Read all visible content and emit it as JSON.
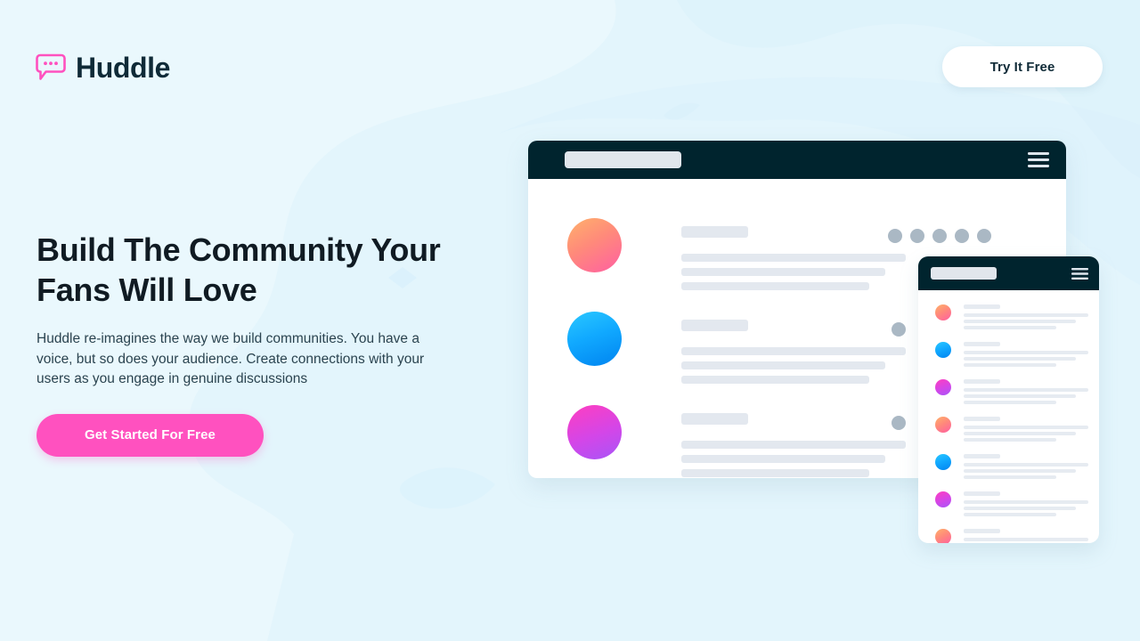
{
  "page": {
    "background_color": "#eaf8fd",
    "accent_pink": "#ff51bf",
    "dark_navy": "#00242e"
  },
  "header": {
    "brand": {
      "name": "Huddle",
      "logo_icon": "speech-bubble-icon",
      "logo_color": "#ff51bf"
    },
    "try_free_label": "Try It Free"
  },
  "hero": {
    "title": "Build The Community Your Fans Will Love",
    "subtitle": "Huddle re-imagines the way we build communities. You have a voice, but so does your audience. Create connections with your users as you engage in genuine discussions",
    "cta_label": "Get Started For Free"
  },
  "mockup": {
    "window": {
      "topbar_icon": "hamburger-menu-icon",
      "rows": [
        {
          "avatar_gradient": "grad-warm",
          "dots": 5
        },
        {
          "avatar_gradient": "grad-cool",
          "dots": 1
        },
        {
          "avatar_gradient": "grad-mag",
          "dots": 1
        }
      ]
    },
    "card": {
      "topbar_icon": "hamburger-menu-icon",
      "rows": [
        {
          "avatar_gradient": "grad-warm"
        },
        {
          "avatar_gradient": "grad-cool"
        },
        {
          "avatar_gradient": "grad-mag"
        },
        {
          "avatar_gradient": "grad-warm"
        },
        {
          "avatar_gradient": "grad-cool"
        },
        {
          "avatar_gradient": "grad-mag"
        },
        {
          "avatar_gradient": "grad-warm"
        },
        {
          "avatar_gradient": "grad-cool"
        }
      ]
    }
  }
}
